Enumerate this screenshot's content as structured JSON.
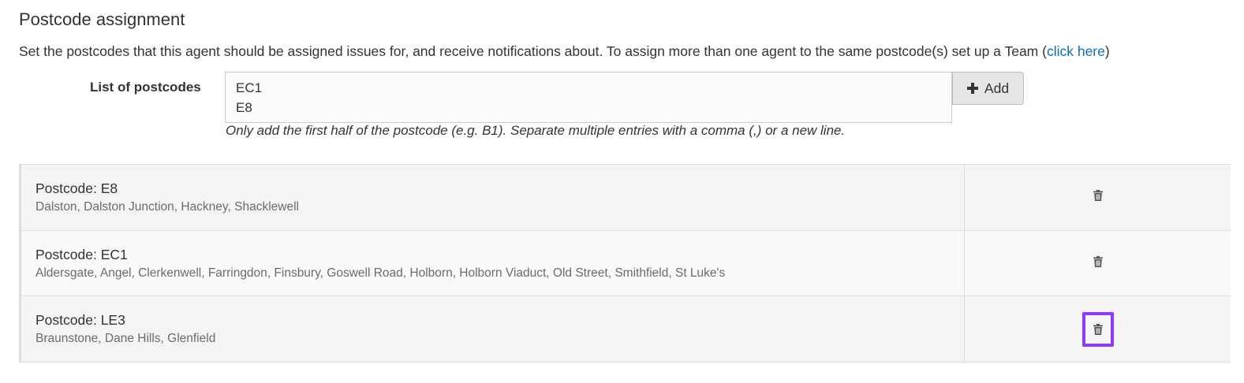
{
  "section": {
    "title": "Postcode assignment",
    "description": "Set the postcodes that this agent should be assigned issues for, and receive notifications about. To assign more than one agent to the same postcode(s) set up a Team (",
    "link_text": "click here",
    "description_end": ")"
  },
  "form": {
    "label": "List of postcodes",
    "textarea_value": "EC1\nE8",
    "add_button_label": "Add",
    "add_button_icon": "plus-icon",
    "help_text": "Only add the first half of the postcode (e.g. B1). Separate multiple entries with a comma (,) or a new line."
  },
  "postcodes": [
    {
      "title": "Postcode: E8",
      "areas": "Dalston, Dalston Junction, Hackney, Shacklewell",
      "action_icon": "trash-icon"
    },
    {
      "title": "Postcode: EC1",
      "areas": "Aldersgate, Angel, Clerkenwell, Farringdon, Finsbury, Goswell Road, Holborn, Holborn Viaduct, Old Street, Smithfield, St Luke's",
      "action_icon": "trash-icon"
    },
    {
      "title": "Postcode: LE3",
      "areas": "Braunstone, Dane Hills, Glenfield",
      "action_icon": "trash-icon"
    }
  ],
  "colors": {
    "link": "#0b6fb5",
    "highlight": "#8b3df5",
    "icon": "#555555"
  }
}
